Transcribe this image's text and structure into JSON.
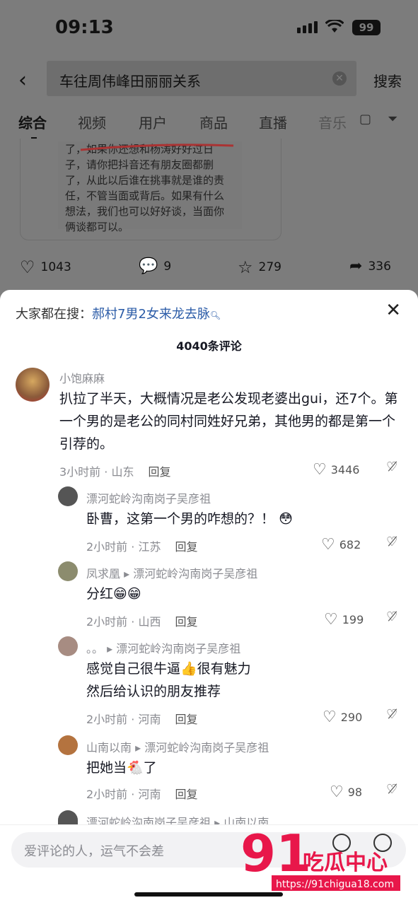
{
  "status": {
    "time": "09:13",
    "battery": "99"
  },
  "search": {
    "query": "车往周伟峰田丽丽关系",
    "button": "搜索"
  },
  "tabs": [
    "综合",
    "视频",
    "用户",
    "商品",
    "直播",
    "音乐"
  ],
  "post": {
    "text_lines": [
      "了，如果你还想和杨涛好好过日",
      "子，请你把抖音还有朋友圈都删",
      "了，从此以后谁在挑事就是谁的责",
      "任，不管当面或背后。如果有什么",
      "想法，我们也可以好好谈，当面你",
      "俩谈都可以。"
    ],
    "likes": "1043",
    "comments": "9",
    "favorites": "279",
    "shares": "336"
  },
  "comments_sheet": {
    "hot_label": "大家都在搜：",
    "hot_keyword": "郝村7男2女来龙去脉",
    "count_label": "4040条评论",
    "reply_label": "回复",
    "comments": [
      {
        "name": "小饱麻麻",
        "text": "扒拉了半天，大概情况是老公发现老婆出gui，还7个。第一个男的是老公的同村同姓好兄弟，其他男的都是第一个引荐的。",
        "meta": "3小时前 · 山东",
        "likes": "3446"
      },
      {
        "name": "漂河蛇岭沟南岗子吴彦祖",
        "text": "卧曹，这第一个男的咋想的？！",
        "emoji": "😳",
        "meta": "2小时前 · 江苏",
        "likes": "682"
      },
      {
        "name": "凤求凰",
        "reply_to": "漂河蛇岭沟南岗子吴彦祖",
        "text": "分红",
        "emoji": "😁😁",
        "meta": "2小时前 · 山西",
        "likes": "199"
      },
      {
        "name": "。。",
        "reply_to": "漂河蛇岭沟南岗子吴彦祖",
        "text": "感觉自己很牛逼👍很有魅力",
        "text2": "然后给认识的朋友推荐",
        "meta": "2小时前 · 河南",
        "likes": "290"
      },
      {
        "name": "山南以南",
        "reply_to": "漂河蛇岭沟南岗子吴彦祖",
        "text": "把她当🐔了",
        "meta": "2小时前 · 河南",
        "likes": "98"
      },
      {
        "name": "漂河蛇岭沟南岗子吴彦祖",
        "reply_to": "山南以南"
      }
    ]
  },
  "input": {
    "placeholder": "爱评论的人，运气不会差"
  },
  "watermark": {
    "logo": "91吃瓜中心",
    "url": "https://91chigua18.com"
  }
}
